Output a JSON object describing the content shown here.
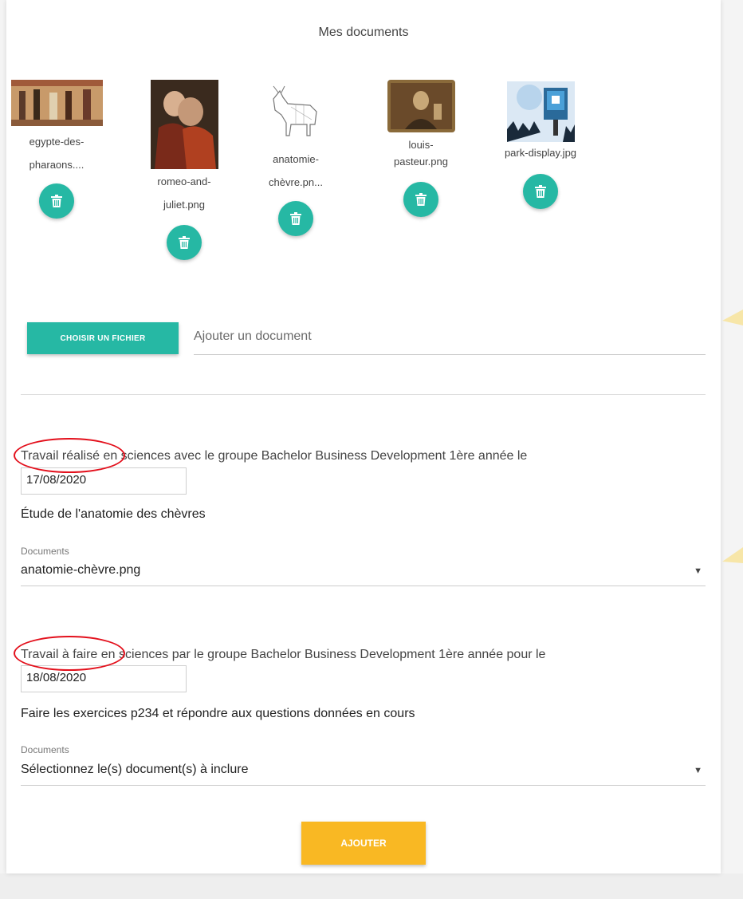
{
  "section_title": "Mes documents",
  "documents": [
    {
      "name_line1": "egypte-des-",
      "name_line2": "pharaons....",
      "thumb_icon": "egyptian-painting-thumbnail"
    },
    {
      "name_line1": "romeo-and-",
      "name_line2": "juliet.png",
      "thumb_icon": "painting-couple-thumbnail"
    },
    {
      "name_line1": "anatomie-",
      "name_line2": "chèvre.pn...",
      "thumb_icon": "goat-sketch-thumbnail"
    },
    {
      "name_line1": "louis-",
      "name_line2": "pasteur.png",
      "thumb_icon": "portrait-thumbnail"
    },
    {
      "name_line1": "park-display.jpg",
      "name_line2": "",
      "thumb_icon": "park-display-thumbnail"
    }
  ],
  "upload": {
    "button_label": "CHOISIR UN FICHIER",
    "placeholder": "Ajouter un document"
  },
  "done_work": {
    "sentence": "Travail réalisé en sciences avec le groupe Bachelor Business Development 1ère année le",
    "date": "17/08/2020",
    "description": "Étude de l'anatomie des chèvres",
    "documents_label": "Documents",
    "documents_value": "anatomie-chèvre.png"
  },
  "todo_work": {
    "sentence": "Travail à faire en sciences par le groupe Bachelor Business Development 1ère année pour le",
    "date": "18/08/2020",
    "description": "Faire les exercices p234 et répondre aux questions données en cours",
    "documents_label": "Documents",
    "documents_value": "Sélectionnez le(s) document(s) à inclure"
  },
  "add_button_label": "AJOUTER",
  "colors": {
    "teal": "#26b8a4",
    "amber": "#f9b823",
    "annotation_red": "#e3101c"
  }
}
